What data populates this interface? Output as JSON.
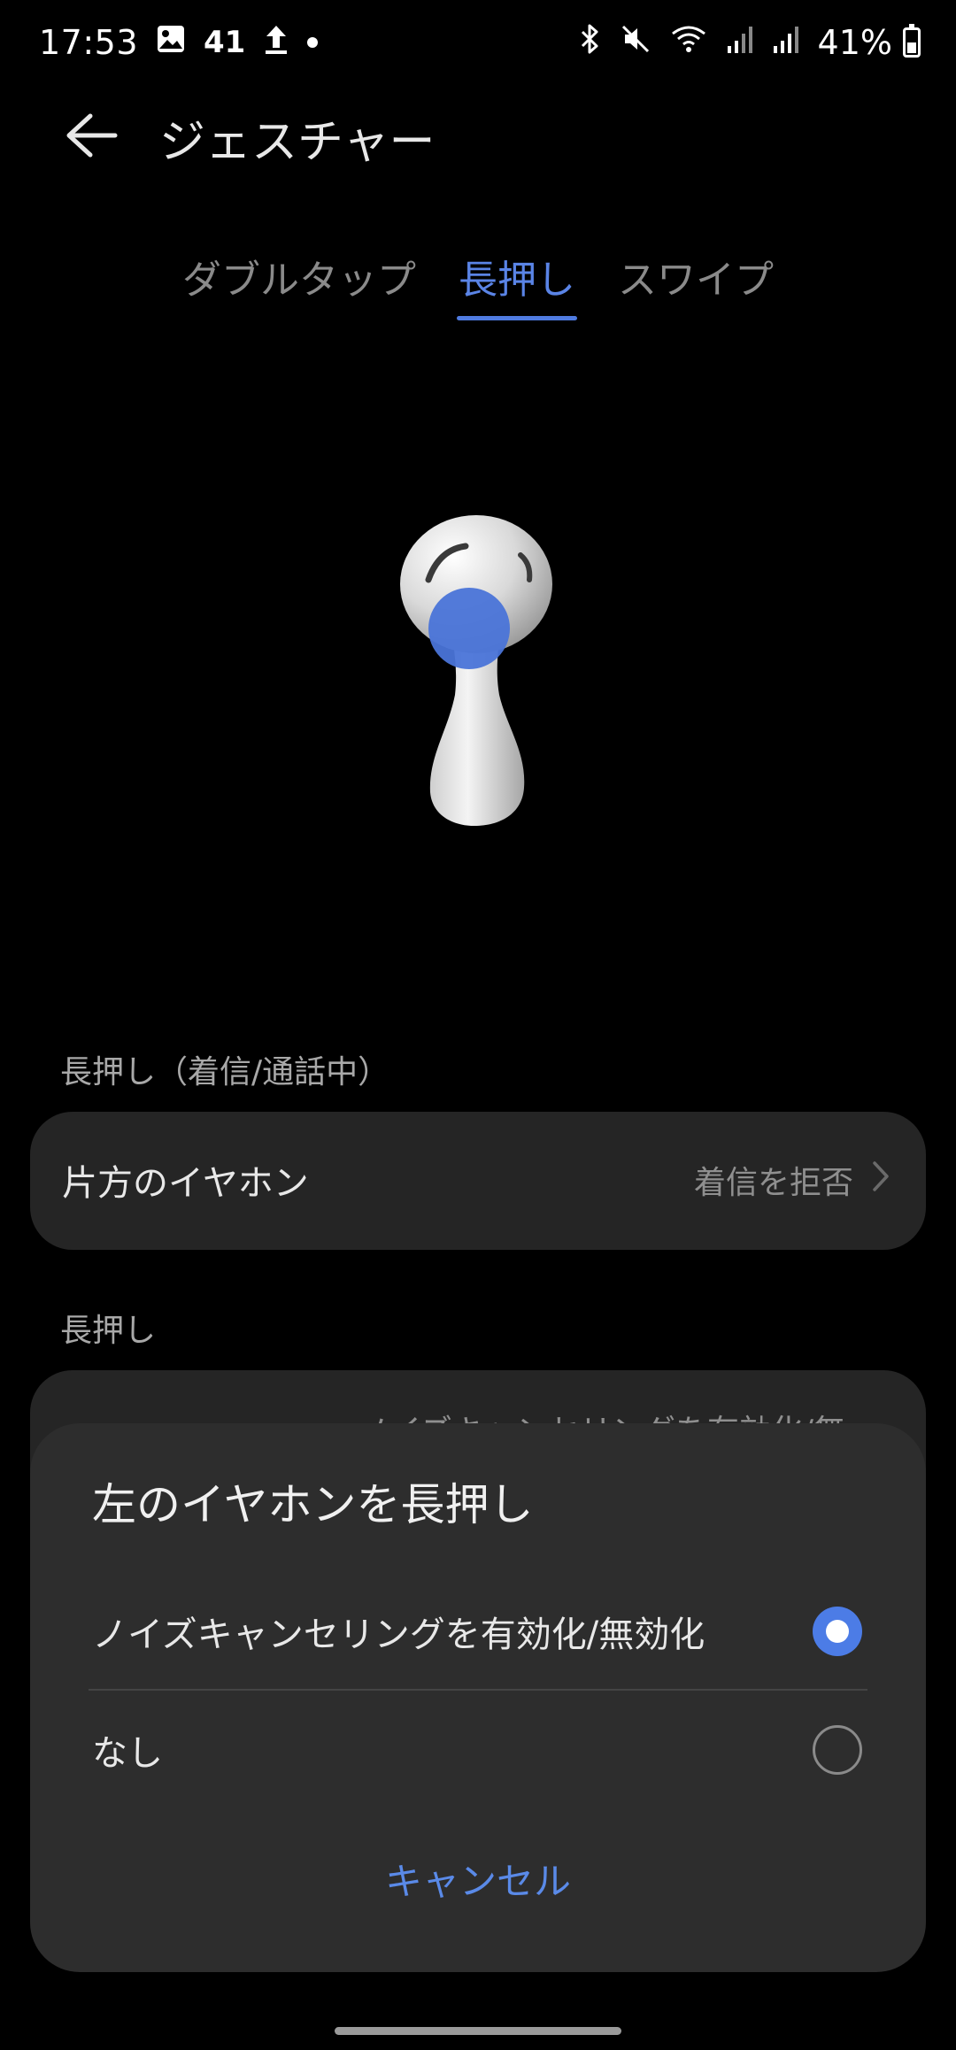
{
  "status_bar": {
    "time": "17:53",
    "notification_count": "41",
    "battery": "41%"
  },
  "header": {
    "title": "ジェスチャー"
  },
  "tabs": [
    {
      "label": "ダブルタップ",
      "active": false
    },
    {
      "label": "長押し",
      "active": true
    },
    {
      "label": "スワイプ",
      "active": false
    }
  ],
  "sections": {
    "call_label": "長押し（着信/通話中）",
    "call_row_label": "片方のイヤホン",
    "call_row_value": "着信を拒否",
    "longpress_label": "長押し",
    "longpress_row_partial": "ノイズキャンセリングを有効化/無"
  },
  "dialog": {
    "title": "左のイヤホンを長押し",
    "options": [
      {
        "label": "ノイズキャンセリングを有効化/無効化",
        "selected": true
      },
      {
        "label": "なし",
        "selected": false
      }
    ],
    "cancel": "キャンセル"
  },
  "colors": {
    "accent": "#4f7be0",
    "background": "#000000",
    "card": "#252525",
    "sheet": "#2d2d2d"
  }
}
